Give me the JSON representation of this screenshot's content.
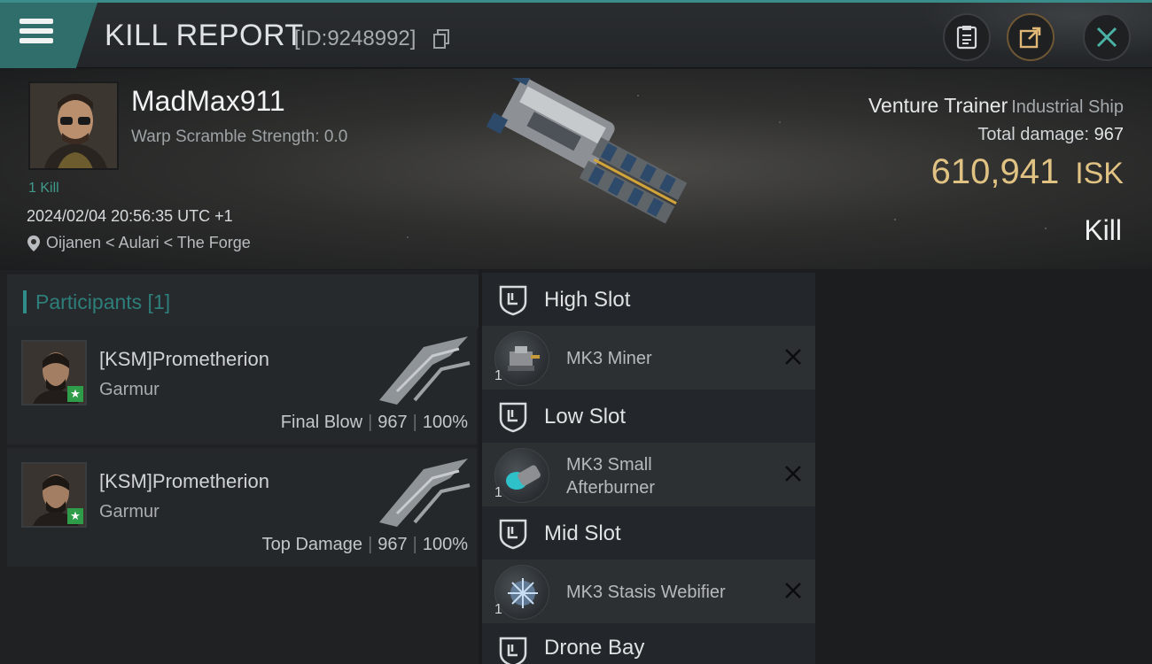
{
  "header": {
    "title": "KILL REPORT",
    "report_id": "[ID:9248992]"
  },
  "victim": {
    "name": "MadMax911",
    "warp_scramble": "Warp Scramble Strength: 0.0",
    "kills": "1 Kill",
    "datetime": "2024/02/04 20:56:35 UTC +1",
    "location": "Oijanen < Aulari < The Forge",
    "ship_name": "Venture Trainer",
    "ship_class": "Industrial Ship",
    "total_damage_label": "Total damage:",
    "total_damage_value": "967",
    "isk_value": "610,941",
    "isk_unit": "ISK",
    "kill_type": "Kill"
  },
  "participants": {
    "title": "Participants [1]",
    "rows": [
      {
        "name": "[KSM]Prometherion",
        "ship": "Garmur",
        "role": "Final Blow",
        "damage": "967",
        "percent": "100%"
      },
      {
        "name": "[KSM]Prometherion",
        "ship": "Garmur",
        "role": "Top Damage",
        "damage": "967",
        "percent": "100%"
      }
    ]
  },
  "fitting": {
    "high_slot": "High Slot",
    "low_slot": "Low Slot",
    "mid_slot": "Mid Slot",
    "drone_bay": "Drone Bay",
    "modules": [
      {
        "name": "MK3 Miner",
        "qty": "1"
      },
      {
        "name_line1": "MK3 Small",
        "name_line2": "Afterburner",
        "qty": "1"
      },
      {
        "name": "MK3 Stasis Webifier",
        "qty": "1"
      }
    ]
  },
  "colors": {
    "accent_teal": "#2f6e6b",
    "isk_gold": "#e0c283",
    "kill_green": "#3f9b8c",
    "star_badge": "#2f9c4a"
  },
  "icons": [
    "menu-icon",
    "copy-icon",
    "clipboard-icon",
    "share-icon",
    "close-icon",
    "location-pin-icon",
    "slot-shield-icon",
    "remove-x-icon",
    "star-badge-icon"
  ]
}
